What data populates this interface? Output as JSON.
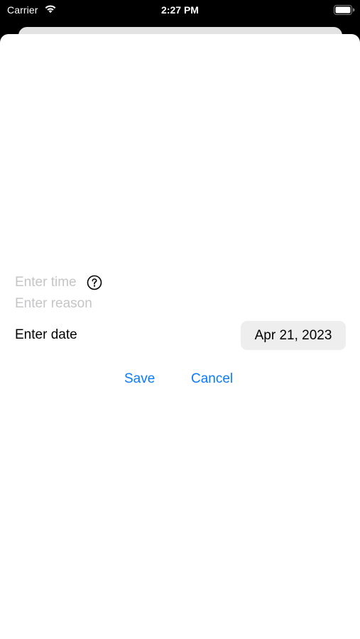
{
  "status_bar": {
    "carrier": "Carrier",
    "time": "2:27 PM",
    "icons": [
      "wifi-icon",
      "battery-icon"
    ]
  },
  "form": {
    "time_placeholder": "Enter time",
    "help_icon": "question-circle-icon",
    "reason_placeholder": "Enter reason",
    "date_label": "Enter date",
    "date_value": "Apr 21, 2023"
  },
  "actions": {
    "save_label": "Save",
    "cancel_label": "Cancel"
  },
  "colors": {
    "accent": "#0a7aff",
    "placeholder": "#c5c5c7",
    "pill_bg": "#eeeeef"
  }
}
